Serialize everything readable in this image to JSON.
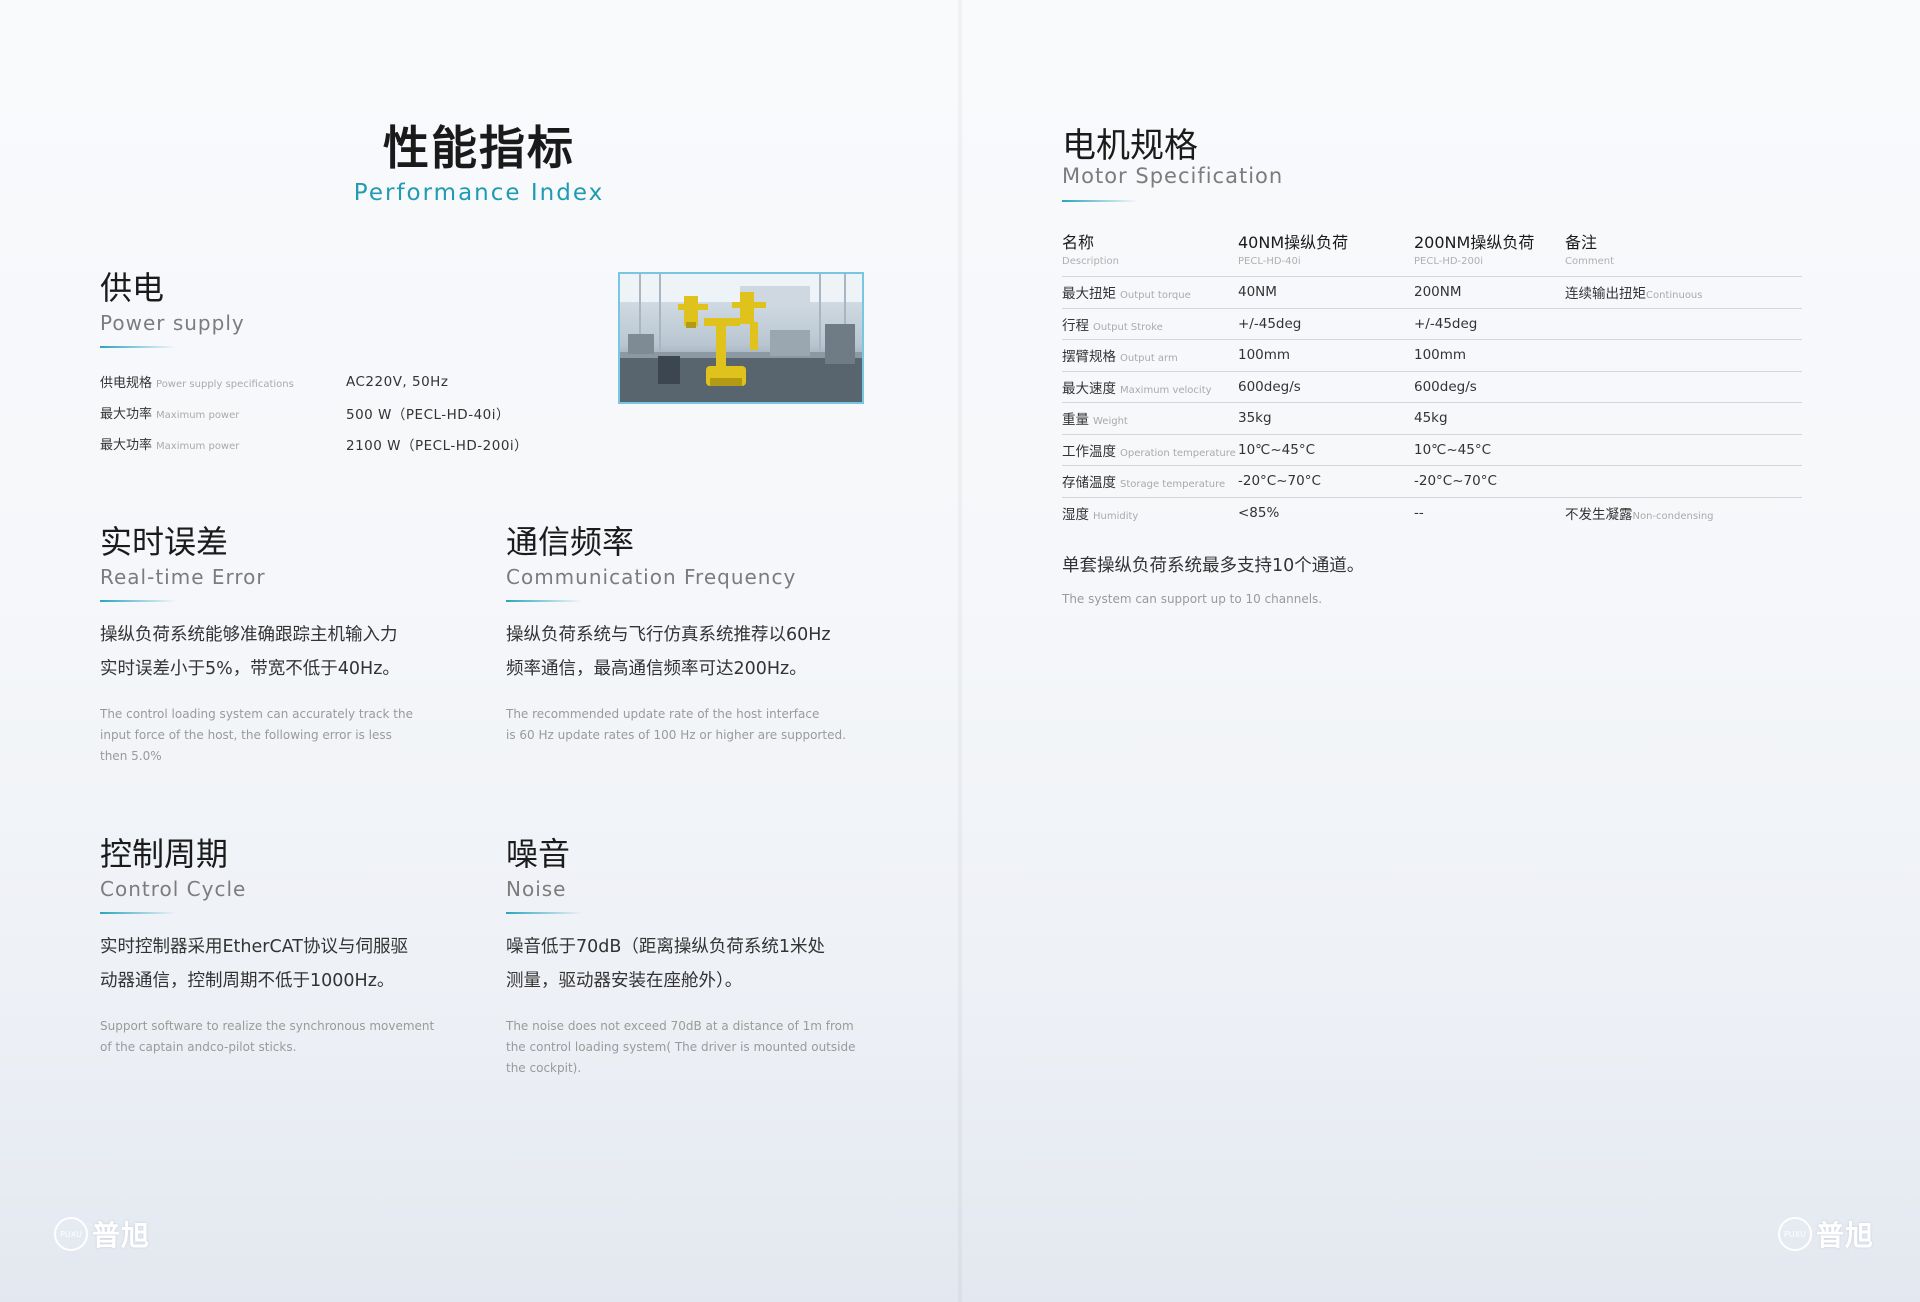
{
  "left": {
    "title": "性能指标",
    "subtitle": "Performance Index",
    "power": {
      "title_cn": "供电",
      "title_en": "Power supply",
      "rows": [
        {
          "key_cn": "供电规格",
          "key_en": "Power supply specifications",
          "value": "AC220V, 50Hz"
        },
        {
          "key_cn": "最大功率",
          "key_en": "Maximum power",
          "value": "500 W（PECL-HD-40i）"
        },
        {
          "key_cn": "最大功率",
          "key_en": "Maximum power",
          "value": "2100 W（PECL-HD-200i）"
        }
      ]
    },
    "realtime": {
      "title_cn": "实时误差",
      "title_en": "Real-time Error",
      "body_cn_1": "操纵负荷系统能够准确跟踪主机输入力",
      "body_cn_2": "实时误差小于5%，带宽不低于40Hz。",
      "body_en_1": "The control loading system can accurately track the",
      "body_en_2": "input force of the host, the following error is less",
      "body_en_3": "then 5.0%"
    },
    "comm": {
      "title_cn": "通信频率",
      "title_en": "Communication Frequency",
      "body_cn_1": "操纵负荷系统与飞行仿真系统推荐以60Hz",
      "body_cn_2": "频率通信，最高通信频率可达200Hz。",
      "body_en_1": "The recommended update rate of the host interface",
      "body_en_2": "is 60 Hz update rates of 100 Hz or higher are supported."
    },
    "cycle": {
      "title_cn": "控制周期",
      "title_en": "Control Cycle",
      "body_cn_1": "实时控制器采用EtherCAT协议与伺服驱",
      "body_cn_2": "动器通信，控制周期不低于1000Hz。",
      "body_en_1": "Support software to realize the synchronous movement",
      "body_en_2": "of the captain andco-pilot sticks."
    },
    "noise": {
      "title_cn": "噪音",
      "title_en": "Noise",
      "body_cn_1": "噪音低于70dB（距离操纵负荷系统1米处",
      "body_cn_2": "测量，驱动器安装在座舱外）。",
      "body_en_1": "The noise does not exceed 70dB at a distance of 1m from",
      "body_en_2": "the control loading system( The driver is mounted outside",
      "body_en_3": "the cockpit)."
    },
    "logo": {
      "mark": "PUXU",
      "text": "普旭"
    }
  },
  "right": {
    "title_cn": "电机规格",
    "title_en": "Motor Specification",
    "headers": [
      {
        "cn": "名称",
        "en": "Description"
      },
      {
        "cn": "40NM操纵负荷",
        "en": "PECL-HD-40i"
      },
      {
        "cn": "200NM操纵负荷",
        "en": "PECL-HD-200i"
      },
      {
        "cn": "备注",
        "en": "Comment"
      }
    ],
    "rows": [
      {
        "name_cn": "最大扭矩",
        "name_en": "Output torque",
        "v40": "40NM",
        "v200": "200NM",
        "note_cn": "连续输出扭矩",
        "note_en": "Continuous"
      },
      {
        "name_cn": "行程",
        "name_en": "Output Stroke",
        "v40": "+/-45deg",
        "v200": "+/-45deg",
        "note_cn": "",
        "note_en": ""
      },
      {
        "name_cn": "摆臂规格",
        "name_en": "Output arm",
        "v40": "100mm",
        "v200": "100mm",
        "note_cn": "",
        "note_en": ""
      },
      {
        "name_cn": "最大速度",
        "name_en": "Maximum velocity",
        "v40": "600deg/s",
        "v200": "600deg/s",
        "note_cn": "",
        "note_en": ""
      },
      {
        "name_cn": "重量",
        "name_en": "Weight",
        "v40": "35kg",
        "v200": "45kg",
        "note_cn": "",
        "note_en": ""
      },
      {
        "name_cn": "工作温度",
        "name_en": "Operation temperature",
        "v40": "10℃~45°C",
        "v200": "10℃~45°C",
        "note_cn": "",
        "note_en": ""
      },
      {
        "name_cn": "存储温度",
        "name_en": "Storage temperature",
        "v40": "-20°C~70°C",
        "v200": "-20°C~70°C",
        "note_cn": "",
        "note_en": ""
      },
      {
        "name_cn": "湿度",
        "name_en": "Humidity",
        "v40": "<85%",
        "v200": "--",
        "note_cn": "不发生凝露",
        "note_en": "Non-condensing"
      }
    ],
    "note_cn": "单套操纵负荷系统最多支持10个通道。",
    "note_en": "The system can support up to 10 channels.",
    "logo": {
      "mark": "PUXU",
      "text": "普旭"
    }
  },
  "colors": {
    "accent": "#1f9bb3",
    "frame": "#79c6e3",
    "machine": "#e0c21c"
  }
}
